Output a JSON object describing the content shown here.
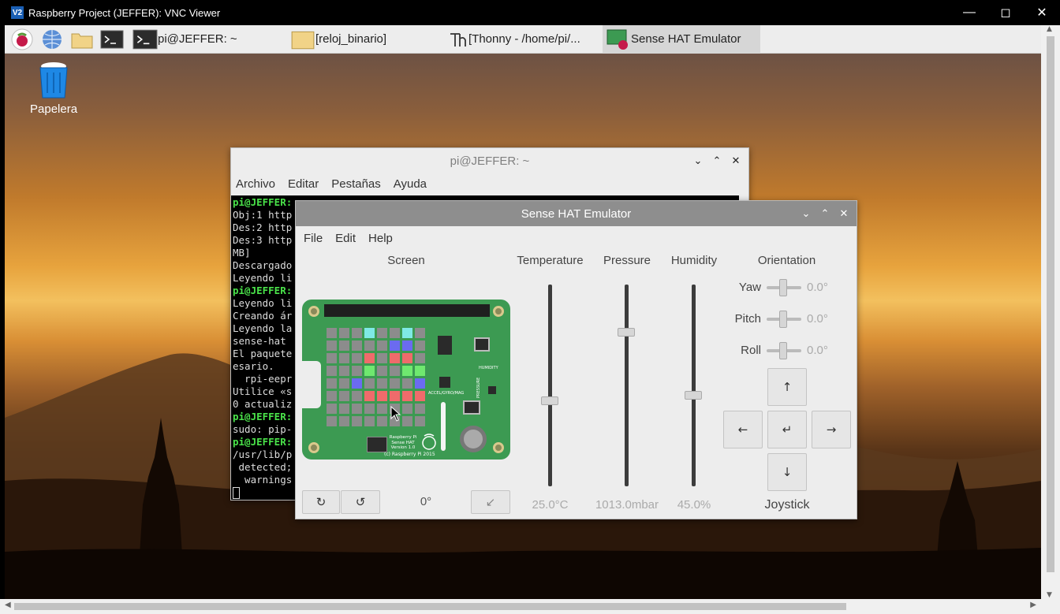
{
  "vnc": {
    "title": "Raspberry Project (JEFFER): VNC Viewer",
    "logo": "V2"
  },
  "taskbar": {
    "tasks": [
      {
        "label": "pi@JEFFER: ~"
      },
      {
        "label": "[reloj_binario]"
      },
      {
        "label": "[Thonny  -  /home/pi/..."
      },
      {
        "label": "Sense HAT Emulator"
      }
    ]
  },
  "desktop": {
    "trash_label": "Papelera"
  },
  "terminal": {
    "title": "pi@JEFFER: ~",
    "menu": [
      "Archivo",
      "Editar",
      "Pestañas",
      "Ayuda"
    ],
    "lines": [
      {
        "prompt": "pi@JEFFER:",
        "text": ""
      },
      {
        "prompt": "",
        "text": "Obj:1 http"
      },
      {
        "prompt": "",
        "text": "Des:2 http"
      },
      {
        "prompt": "",
        "text": "Des:3 http"
      },
      {
        "prompt": "",
        "text": "MB]"
      },
      {
        "prompt": "",
        "text": "Descargado"
      },
      {
        "prompt": "",
        "text": "Leyendo li"
      },
      {
        "prompt": "pi@JEFFER:",
        "text": ""
      },
      {
        "prompt": "",
        "text": "Leyendo li"
      },
      {
        "prompt": "",
        "text": "Creando ár"
      },
      {
        "prompt": "",
        "text": "Leyendo la"
      },
      {
        "prompt": "",
        "text": "sense-hat"
      },
      {
        "prompt": "",
        "text": "El paquete"
      },
      {
        "prompt": "",
        "text": "esario."
      },
      {
        "prompt": "",
        "text": "  rpi-eepr"
      },
      {
        "prompt": "",
        "text": "Utilice «s"
      },
      {
        "prompt": "",
        "text": "0 actualiz"
      },
      {
        "prompt": "pi@JEFFER:",
        "text": ""
      },
      {
        "prompt": "",
        "text": "sudo: pip-"
      },
      {
        "prompt": "pi@JEFFER:",
        "text": ""
      },
      {
        "prompt": "",
        "text": "/usr/lib/p"
      },
      {
        "prompt": "",
        "text": " detected;"
      },
      {
        "prompt": "",
        "text": "  warnings"
      }
    ]
  },
  "emulator": {
    "title": "Sense HAT Emulator",
    "menu": [
      "File",
      "Edit",
      "Help"
    ],
    "screen_label": "Screen",
    "board_text": {
      "humidity": "HUMIDITY",
      "pressure": "PRESSURE",
      "accel": "ACCEL/GYRO/MAG",
      "brand1": "Raspberry Pi",
      "brand2": "Sense HAT",
      "brand3": "Version 1.0",
      "copyright": "(c) Raspberry Pi 2015"
    },
    "led_colors": {
      "off": "#8c8c8c",
      "cyan": "#7fe9e5",
      "blue": "#6b6bf0",
      "red": "#ef6b6b",
      "green": "#6fe86f"
    },
    "leds": [
      [
        "off",
        "off",
        "off",
        "cyan",
        "off",
        "off",
        "cyan",
        "off"
      ],
      [
        "off",
        "off",
        "off",
        "off",
        "off",
        "blue",
        "blue",
        "off"
      ],
      [
        "off",
        "off",
        "off",
        "red",
        "off",
        "red",
        "red",
        "off"
      ],
      [
        "off",
        "off",
        "off",
        "green",
        "off",
        "off",
        "green",
        "green"
      ],
      [
        "off",
        "off",
        "blue",
        "off",
        "off",
        "off",
        "off",
        "blue"
      ],
      [
        "off",
        "off",
        "off",
        "red",
        "red",
        "red",
        "red",
        "red"
      ],
      [
        "off",
        "off",
        "off",
        "off",
        "off",
        "off",
        "off",
        "off"
      ],
      [
        "off",
        "off",
        "off",
        "off",
        "off",
        "off",
        "off",
        "off"
      ]
    ],
    "rotation": "0°",
    "temperature": {
      "label": "Temperature",
      "value": "25.0°C",
      "level": 0.42
    },
    "pressure": {
      "label": "Pressure",
      "value": "1013.0mbar",
      "level": 0.76
    },
    "humidity": {
      "label": "Humidity",
      "value": "45.0%",
      "level": 0.45
    },
    "orientation": {
      "label": "Orientation",
      "yaw": {
        "label": "Yaw",
        "value": "0.0°"
      },
      "pitch": {
        "label": "Pitch",
        "value": "0.0°"
      },
      "roll": {
        "label": "Roll",
        "value": "0.0°"
      }
    },
    "joystick": {
      "label": "Joystick",
      "up": "↑",
      "down": "↓",
      "left": "←",
      "right": "→",
      "enter": "↵"
    }
  }
}
